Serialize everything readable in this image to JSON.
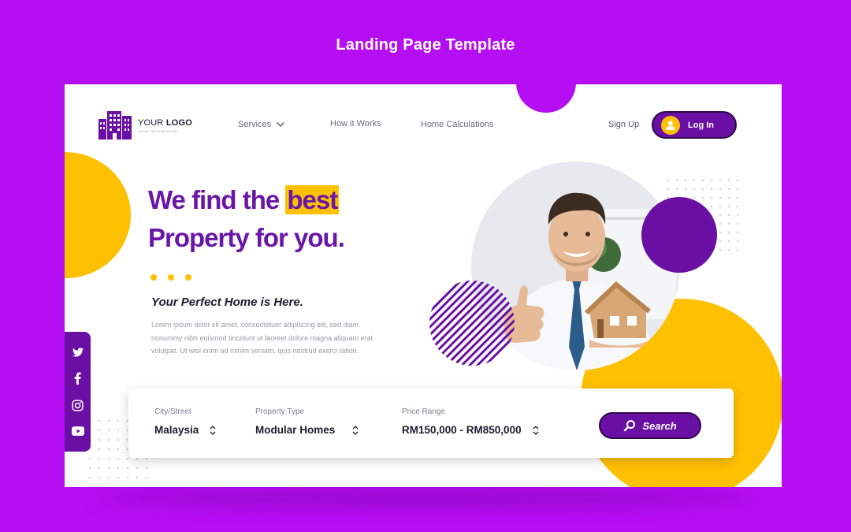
{
  "page": {
    "title": "Landing Page Template"
  },
  "logo": {
    "your": "YOUR",
    "logo": "LOGO",
    "tagline": "YOUR TAGLINE HERE",
    "icon": "building-icon"
  },
  "nav": {
    "services": "Services",
    "how_it_works": "How it Works",
    "home_calculations": "Home Calculations",
    "sign_up": "Sign Up",
    "log_in": "Log In"
  },
  "hero": {
    "line1_prefix": "We find the ",
    "line1_highlight": "best",
    "line2": "Property for you.",
    "subheading": "Your Perfect Home is Here.",
    "body": "Lorem ipsum dolor sit amet, consectetuer adipiscing elit, sed diam nonummy nibh euismod tincidunt ut laoreet dolore magna aliquam erat volutpat. Ut wisi enim ad minim veniam, quis nostrud exerci tation."
  },
  "social": [
    "twitter-icon",
    "facebook-icon",
    "instagram-icon",
    "youtube-icon"
  ],
  "search": {
    "city_label": "City/Street",
    "city_value": "Malaysia",
    "type_label": "Property Type",
    "type_value": "Modular Homes",
    "price_label": "Price Range",
    "price_value": "RM150,000 - RM850,000",
    "button": "Search"
  },
  "colors": {
    "background": "#b60ef3",
    "brand_purple": "#6a0fa3",
    "accent_yellow": "#ffc000",
    "heading_purple": "#6a16a8"
  }
}
